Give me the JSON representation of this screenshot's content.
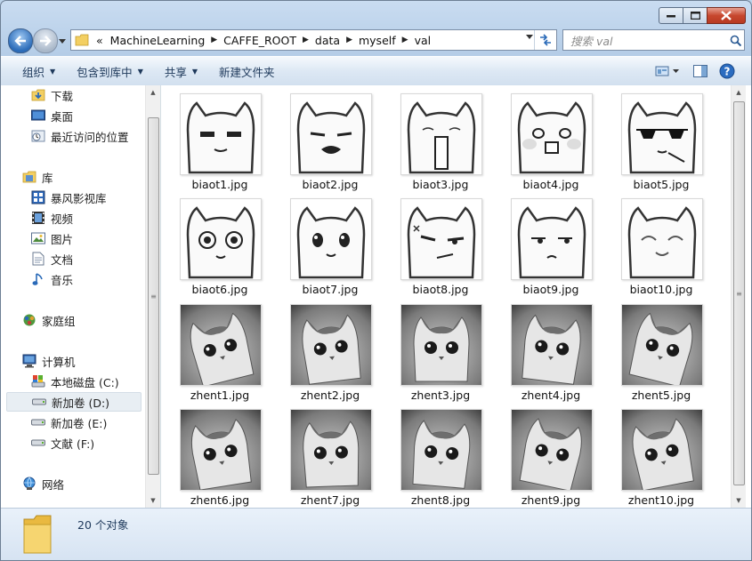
{
  "address": {
    "overflow": "«",
    "crumbs": [
      "MachineLearning",
      "CAFFE_ROOT",
      "data",
      "myself",
      "val"
    ]
  },
  "search": {
    "placeholder": "搜索 val"
  },
  "toolbar": {
    "organize": "组织",
    "include_in_library": "包含到库中",
    "share": "共享",
    "new_folder": "新建文件夹"
  },
  "nav": {
    "downloads": "下载",
    "desktop": "桌面",
    "recent": "最近访问的位置",
    "libraries": "库",
    "storm": "暴风影视库",
    "videos": "视频",
    "pictures": "图片",
    "documents": "文档",
    "music": "音乐",
    "homegroup": "家庭组",
    "computer": "计算机",
    "drive_c": "本地磁盘 (C:)",
    "drive_d": "新加卷 (D:)",
    "drive_e": "新加卷 (E:)",
    "drive_f": "文献 (F:)",
    "network": "网络"
  },
  "files": [
    {
      "name": "biaot1.jpg",
      "kind": "cartoon",
      "face": "squint"
    },
    {
      "name": "biaot2.jpg",
      "kind": "cartoon",
      "face": "cry"
    },
    {
      "name": "biaot3.jpg",
      "kind": "cartoon",
      "face": "tall-mouth"
    },
    {
      "name": "biaot4.jpg",
      "kind": "cartoon",
      "face": "blush"
    },
    {
      "name": "biaot5.jpg",
      "kind": "cartoon",
      "face": "sunglasses"
    },
    {
      "name": "biaot6.jpg",
      "kind": "cartoon",
      "face": "swirl"
    },
    {
      "name": "biaot7.jpg",
      "kind": "cartoon",
      "face": "sparkle"
    },
    {
      "name": "biaot8.jpg",
      "kind": "cartoon",
      "face": "smirk"
    },
    {
      "name": "biaot9.jpg",
      "kind": "cartoon",
      "face": "meh"
    },
    {
      "name": "biaot10.jpg",
      "kind": "cartoon",
      "face": "happy"
    },
    {
      "name": "zhent1.jpg",
      "kind": "photo"
    },
    {
      "name": "zhent2.jpg",
      "kind": "photo"
    },
    {
      "name": "zhent3.jpg",
      "kind": "photo"
    },
    {
      "name": "zhent4.jpg",
      "kind": "photo"
    },
    {
      "name": "zhent5.jpg",
      "kind": "photo"
    },
    {
      "name": "zhent6.jpg",
      "kind": "photo"
    },
    {
      "name": "zhent7.jpg",
      "kind": "photo"
    },
    {
      "name": "zhent8.jpg",
      "kind": "photo"
    },
    {
      "name": "zhent9.jpg",
      "kind": "photo"
    },
    {
      "name": "zhent10.jpg",
      "kind": "photo"
    }
  ],
  "status": {
    "count": "20 个对象"
  },
  "colors": {
    "toolbar_text": "#1e395b",
    "frame": "#bcd3ea"
  }
}
